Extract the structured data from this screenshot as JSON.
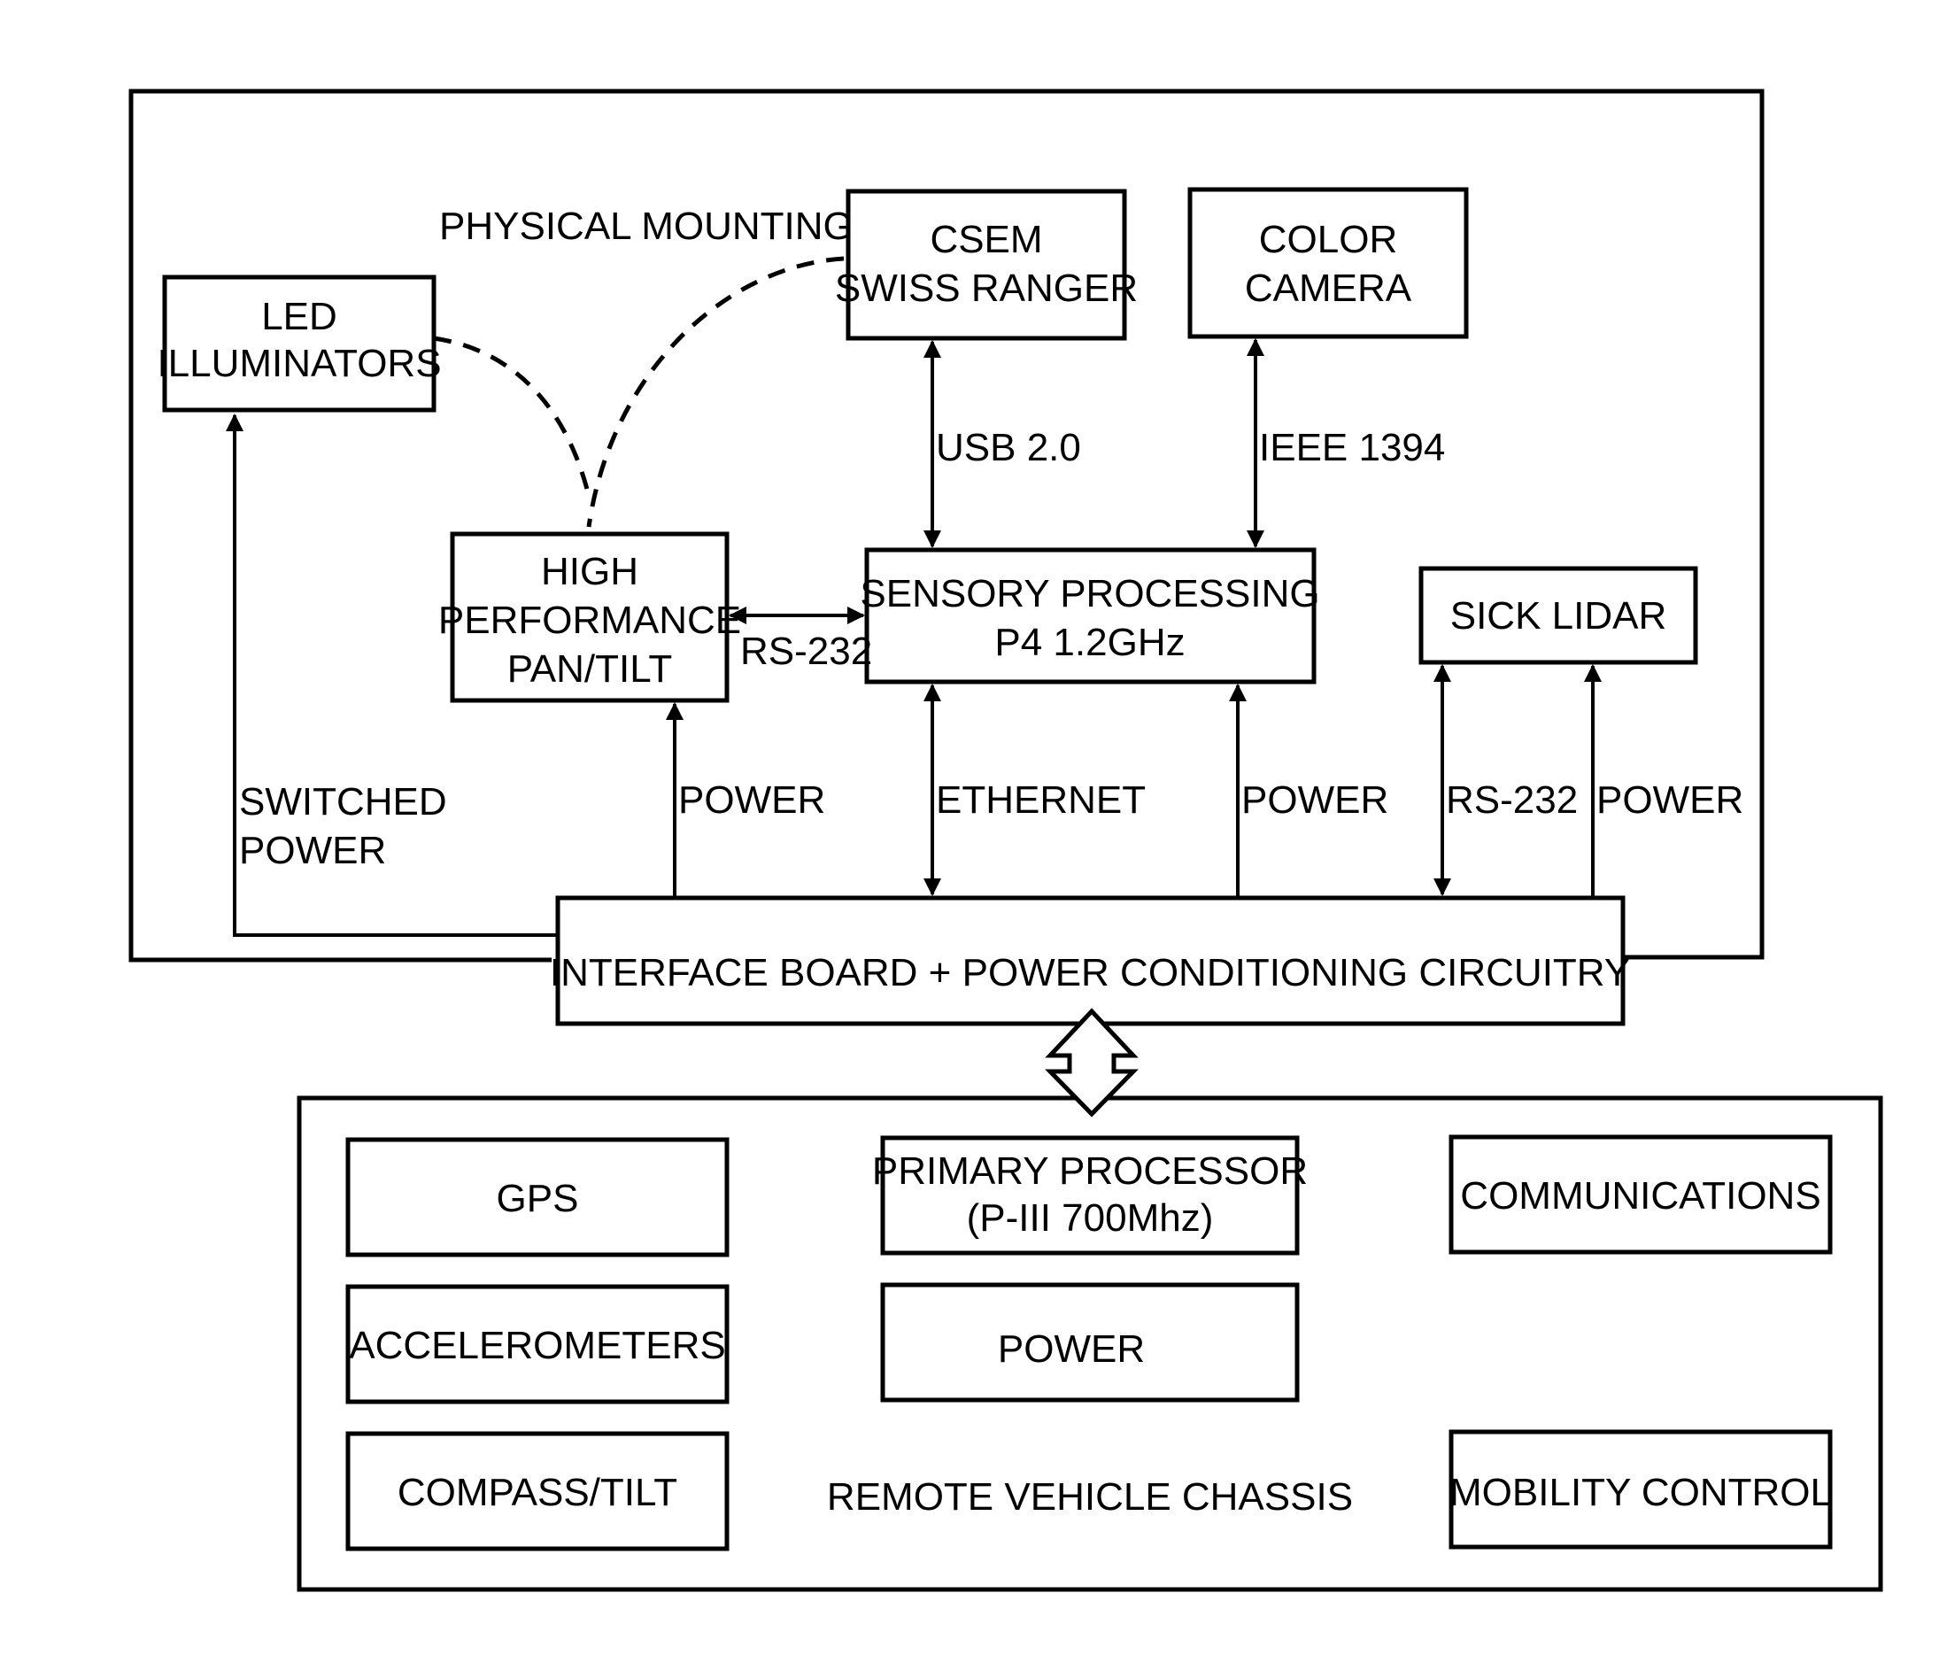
{
  "diagram": {
    "labels": {
      "physical_mounting": "PHYSICAL MOUNTING",
      "switched_power": [
        "SWITCHED",
        "POWER"
      ],
      "usb": "USB 2.0",
      "ieee": "IEEE 1394",
      "rs232_pantilt": "RS-232",
      "power_pantilt": "POWER",
      "ethernet": "ETHERNET",
      "power_sensory": "POWER",
      "rs232_lidar": "RS-232",
      "power_lidar": "POWER",
      "chassis_title": "REMOTE VEHICLE CHASSIS"
    },
    "sensor_head": {
      "led": [
        "LED",
        "ILLUMINATORS"
      ],
      "csem": [
        "CSEM",
        "SWISS RANGER"
      ],
      "camera": [
        "COLOR",
        "CAMERA"
      ],
      "pantilt": [
        "HIGH",
        "PERFORMANCE",
        "PAN/TILT"
      ],
      "sensory": [
        "SENSORY PROCESSING",
        "P4 1.2GHz"
      ],
      "lidar": "SICK LIDAR",
      "interface": "INTERFACE BOARD + POWER CONDITIONING CIRCUITRY"
    },
    "chassis": {
      "gps": "GPS",
      "accelerometers": "ACCELEROMETERS",
      "compass": "COMPASS/TILT",
      "primary": [
        "PRIMARY PROCESSOR",
        "(P-III 700Mhz)"
      ],
      "power": "POWER",
      "communications": "COMMUNICATIONS",
      "mobility": "MOBILITY CONTROL"
    }
  }
}
